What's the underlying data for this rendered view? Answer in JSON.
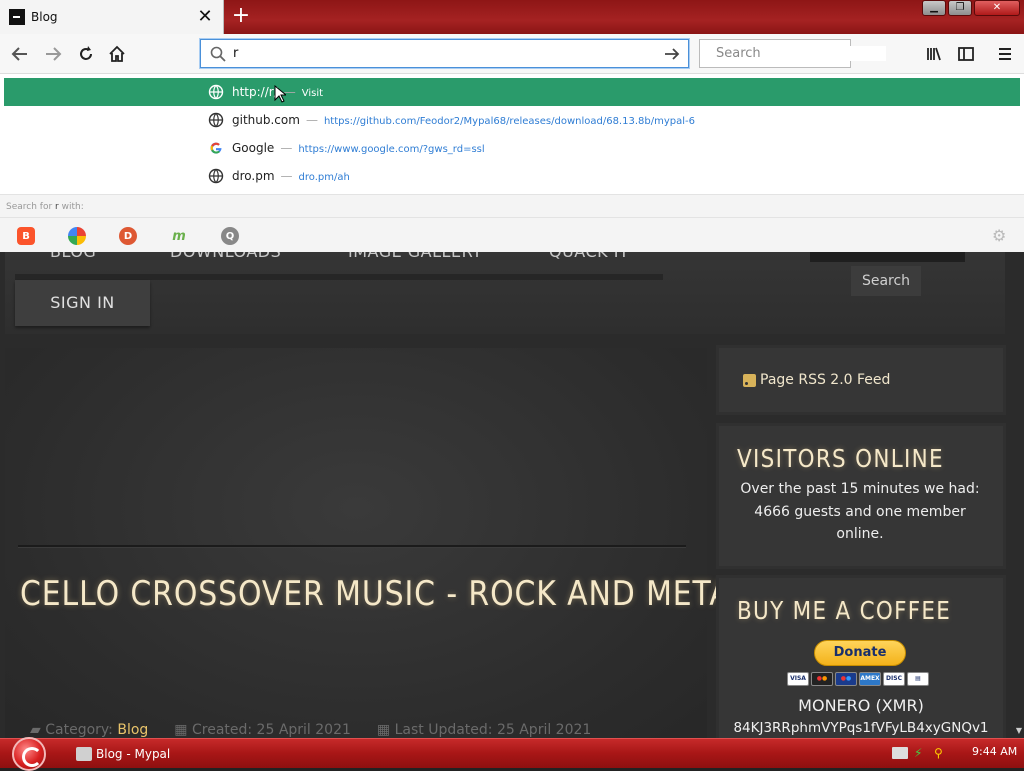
{
  "browser": {
    "tab": {
      "title": "Blog",
      "close_glyph": "✕"
    },
    "new_tab_glyph": "+",
    "window_buttons": {
      "minimize": "▁",
      "restore": "❐",
      "close": "✕"
    },
    "urlbar": {
      "value": "r"
    },
    "searchbar": {
      "placeholder": "Search"
    }
  },
  "dropdown": {
    "rows": [
      {
        "title": "http://r/",
        "dash": "—",
        "url": "Visit"
      },
      {
        "title": "github.com",
        "dash": "—",
        "url": "https://github.com/Feodor2/Mypal68/releases/download/68.13.8b/mypal-6"
      },
      {
        "title": "Google",
        "dash": "—",
        "url": "https://www.google.com/?gws_rd=ssl"
      },
      {
        "title": "dro.pm",
        "dash": "—",
        "url": "dro.pm/ah"
      }
    ],
    "search_with_prefix": "Search for",
    "search_with_term": "r",
    "search_with_suffix": "with:"
  },
  "page": {
    "menu": [
      "BLOG",
      "DOWNLOADS",
      "IMAGE GALLERY",
      "QUACK IT"
    ],
    "signin": "SIGN IN",
    "search_button": "Search",
    "article_title": "CELLO CROSSOVER MUSIC - ROCK AND METAL",
    "meta": {
      "category_label": "Category:",
      "category_value": "Blog",
      "created": "Created: 25 April 2021",
      "updated": "Last Updated: 25 April 2021"
    },
    "sidebar": {
      "rss": "Page RSS 2.0 Feed",
      "visitors_title": "VISITORS ONLINE",
      "visitors_text": "Over the past 15 minutes we had: 4666 guests and one member online.",
      "coffee_title": "BUY ME A COFFEE",
      "donate": "Donate",
      "monero": "MONERO (XMR)",
      "address": "84KJ3RRphmVYPqs1fVFyLB4xyGNQv1"
    }
  },
  "taskbar": {
    "task": "Blog - Mypal",
    "clock": "9:44 AM"
  },
  "colors": {
    "accent_green": "#2a9b6b",
    "title_red": "#a52222",
    "page_bg": "#2b2b2b",
    "heading_cream": "#f5e8c8",
    "link_gold": "#e8c36a"
  }
}
